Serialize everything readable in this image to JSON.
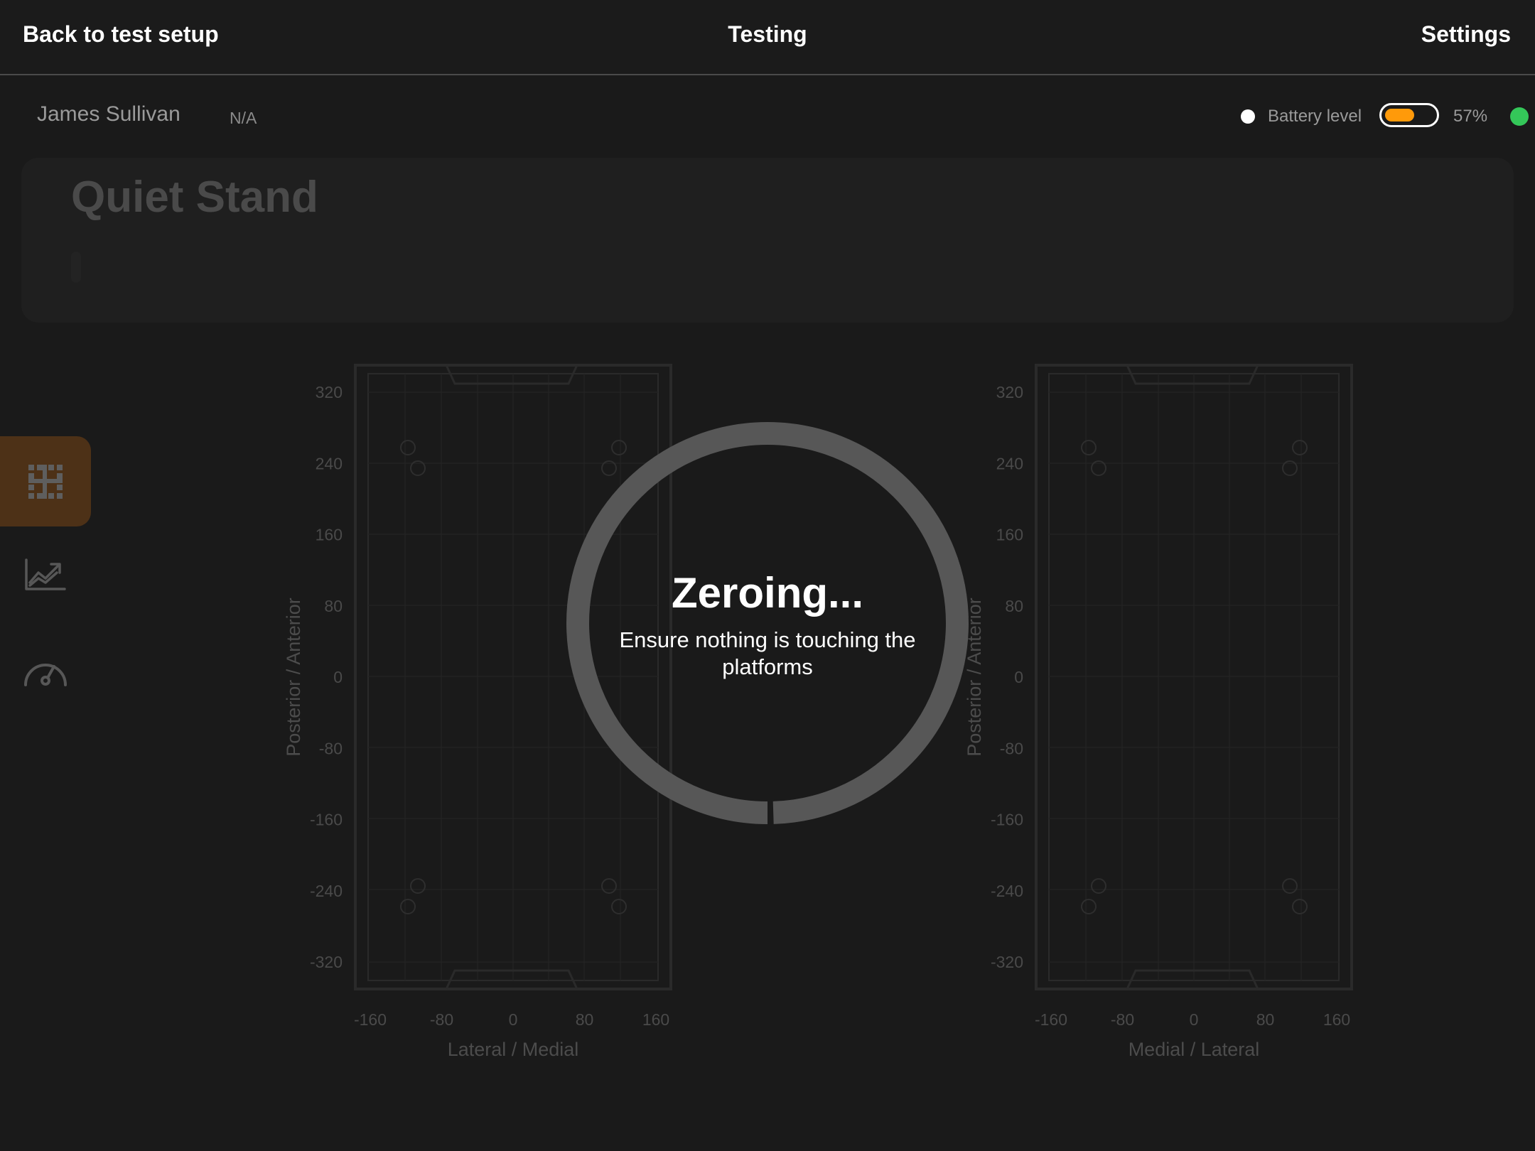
{
  "nav": {
    "back_label": "Back to test setup",
    "title": "Testing",
    "settings_label": "Settings"
  },
  "patient": {
    "name": "James Sullivan",
    "extra": "N/A"
  },
  "device": {
    "battery_label": "Battery level",
    "battery_level_fraction": 0.57,
    "battery_percent_text": "57%",
    "battery_color": "#ff9a0a",
    "connected_color": "#34c759"
  },
  "test": {
    "title": "Quiet Stand"
  },
  "sidebar": {
    "items": [
      {
        "icon": "grid-icon",
        "active": true,
        "active_color": "#4d3117"
      },
      {
        "icon": "line-chart-icon",
        "active": false
      },
      {
        "icon": "gauge-icon",
        "active": false
      }
    ]
  },
  "plots": {
    "y_ticks": [
      "320",
      "240",
      "160",
      "80",
      "0",
      "-80",
      "-160",
      "-240",
      "-320"
    ],
    "x_ticks": [
      "-160",
      "-80",
      "0",
      "80",
      "160"
    ],
    "left": {
      "ylabel": "Posterior / Anterior",
      "xlabel": "Lateral / Medial"
    },
    "right": {
      "ylabel": "Posterior / Anterior",
      "xlabel": "Medial / Lateral"
    }
  },
  "overlay": {
    "title": "Zeroing...",
    "message": "Ensure nothing is touching the platforms",
    "progress_fraction": 0.995
  }
}
